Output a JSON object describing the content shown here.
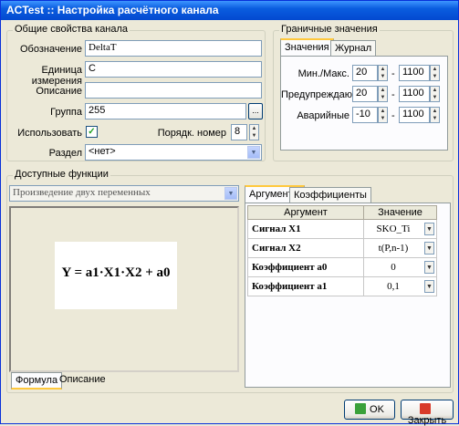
{
  "window": {
    "title": "ACTest :: Настройка расчётного канала"
  },
  "general": {
    "group_title": "Общие свойства канала",
    "designation_label": "Обозначение",
    "designation_value": "DeltaT",
    "unit_label": "Единица измерения",
    "unit_value": "C",
    "description_label": "Описание",
    "description_value": "",
    "group_label": "Группа",
    "group_value": "255",
    "group_btn": "...",
    "use_label": "Использовать",
    "use_checked": "✓",
    "order_label": "Порядк. номер",
    "order_value": "8",
    "section_label": "Раздел",
    "section_value": "<нет>"
  },
  "limits": {
    "group_title": "Граничные значения",
    "tabs": [
      "Значения",
      "Журнал"
    ],
    "rows": [
      {
        "label": "Мин./Макс.",
        "min": "20",
        "max": "1100"
      },
      {
        "label": "Предупреждающие",
        "min": "20",
        "max": "1100"
      },
      {
        "label": "Аварийные",
        "min": "-10",
        "max": "1100"
      }
    ],
    "dash": "-"
  },
  "functions": {
    "group_title": "Доступные функции",
    "selected": "Произведение двух переменных",
    "formula": "Y = a1·X1·X2 + a0",
    "bottom_tabs": [
      "Формула",
      "Описание"
    ],
    "right_tabs": [
      "Аргументы",
      "Коэффициенты"
    ],
    "table_headers": [
      "Аргумент",
      "Значение"
    ],
    "table_rows": [
      {
        "name": "Сигнал X1",
        "value": "SKO_Ti"
      },
      {
        "name": "Сигнал X2",
        "value": "t(P,n-1)"
      },
      {
        "name": "Коэффициент a0",
        "value": "0"
      },
      {
        "name": "Коэффициент a1",
        "value": "0,1"
      }
    ]
  },
  "buttons": {
    "ok": "OK",
    "close": "Закрыть"
  },
  "colors": {
    "ok_icon": "#3aa13a",
    "close_icon": "#d83a2a",
    "accent_tab": "#ffc83c"
  }
}
